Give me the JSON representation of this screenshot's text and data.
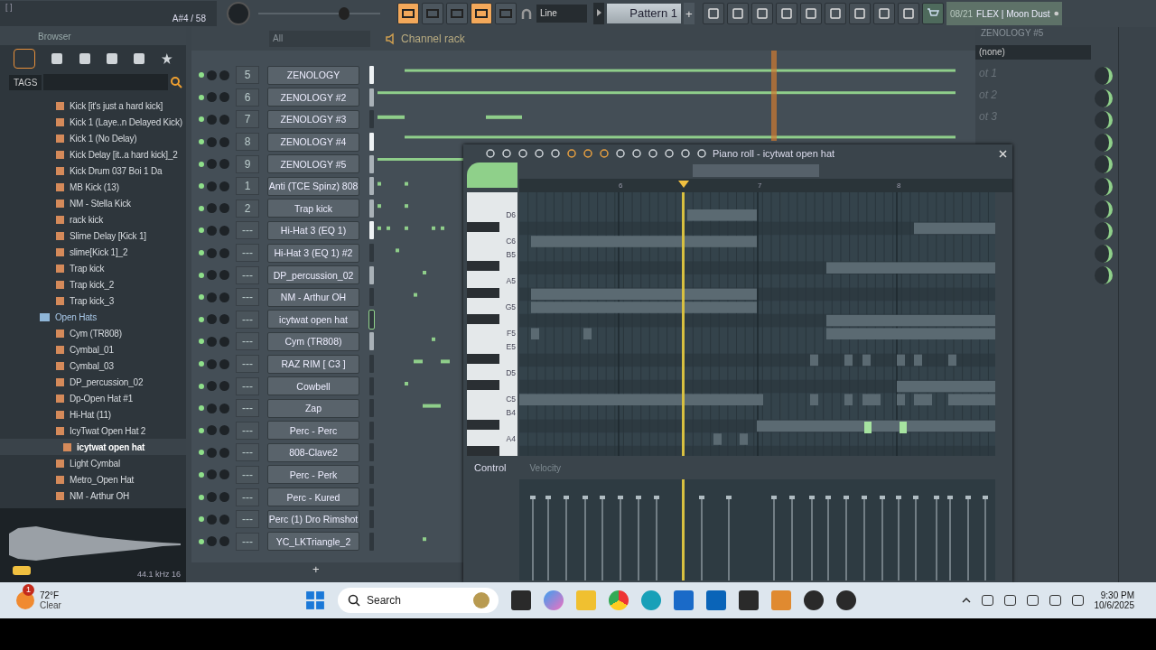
{
  "toolbar": {
    "hint_box": "[ ]",
    "note_readout": "A#4 / 58",
    "master": {
      "level": 0.72
    },
    "buttons": [
      {
        "active": true
      },
      {
        "active": false
      },
      {
        "active": false
      },
      {
        "active": true
      },
      {
        "active": false
      }
    ],
    "snap": "Line",
    "pattern": "Pattern 1",
    "add_pattern": "+",
    "news_count": "08/21",
    "news_title": "FLEX | Moon Dust"
  },
  "browser": {
    "title": "Browser",
    "tags": "TAGS",
    "tree": [
      {
        "kind": "file",
        "label": "Kick [it's just a hard kick]",
        "selected": false
      },
      {
        "kind": "file",
        "label": "Kick 1 (Laye..n Delayed Kick)",
        "selected": false
      },
      {
        "kind": "file",
        "label": "Kick 1 (No Delay)",
        "selected": false
      },
      {
        "kind": "file",
        "label": "Kick Delay [it..a hard kick]_2",
        "selected": false
      },
      {
        "kind": "file",
        "label": "Kick Drum 037 Boi 1 Da",
        "selected": false
      },
      {
        "kind": "file",
        "label": "MB Kick (13)",
        "selected": false
      },
      {
        "kind": "file",
        "label": "NM - Stella Kick",
        "selected": false
      },
      {
        "kind": "file",
        "label": "rack kick",
        "selected": false
      },
      {
        "kind": "file",
        "label": "Slime Delay [Kick 1]",
        "selected": false
      },
      {
        "kind": "file",
        "label": "slime[Kick 1]_2",
        "selected": false
      },
      {
        "kind": "file",
        "label": "Trap kick",
        "selected": false
      },
      {
        "kind": "file",
        "label": "Trap kick_2",
        "selected": false
      },
      {
        "kind": "file",
        "label": "Trap kick_3",
        "selected": false
      },
      {
        "kind": "folder",
        "label": "Open Hats",
        "selected": false,
        "children": [
          {
            "kind": "file",
            "label": "Cym (TR808)",
            "selected": false
          },
          {
            "kind": "file",
            "label": "Cymbal_01",
            "selected": false
          },
          {
            "kind": "file",
            "label": "Cymbal_03",
            "selected": false
          },
          {
            "kind": "file",
            "label": "DP_percussion_02",
            "selected": false
          },
          {
            "kind": "file",
            "label": "Dp-Open Hat #1",
            "selected": false
          },
          {
            "kind": "file",
            "label": "Hi-Hat (11)",
            "selected": false
          },
          {
            "kind": "file",
            "label": "IcyTwat Open Hat 2",
            "selected": false,
            "children": [
              {
                "kind": "file",
                "label": "icytwat open hat",
                "selected": true
              }
            ]
          },
          {
            "kind": "file",
            "label": "Light Cymbal",
            "selected": false
          },
          {
            "kind": "file",
            "label": "Metro_Open Hat",
            "selected": false
          },
          {
            "kind": "file",
            "label": "NM - Arthur OH",
            "selected": false
          }
        ]
      }
    ],
    "sample_info": "44.1 kHz 16"
  },
  "channel_rack": {
    "filter": "All",
    "title": "Channel rack",
    "add": "+",
    "channels": [
      {
        "number": "5",
        "name": "ZENOLOGY",
        "color": "#eef2f4",
        "selected": false
      },
      {
        "number": "6",
        "name": "ZENOLOGY #2",
        "color": "#a9b1b7",
        "selected": false
      },
      {
        "number": "7",
        "name": "ZENOLOGY #3",
        "color": "#2f373d",
        "selected": false
      },
      {
        "number": "8",
        "name": "ZENOLOGY #4",
        "color": "#eef2f4",
        "selected": false
      },
      {
        "number": "9",
        "name": "ZENOLOGY #5",
        "color": "#a9b1b7",
        "selected": false
      },
      {
        "number": "1",
        "name": "Anti (TCE Spinz) 808",
        "color": "#a9b1b7",
        "selected": false
      },
      {
        "number": "2",
        "name": "Trap kick",
        "color": "#a9b1b7",
        "selected": false
      },
      {
        "number": "---",
        "name": "Hi-Hat 3 (EQ 1)",
        "color": "#eef2f4",
        "selected": false
      },
      {
        "number": "---",
        "name": "Hi-Hat 3 (EQ 1) #2",
        "color": "#2f373d",
        "selected": false
      },
      {
        "number": "---",
        "name": "DP_percussion_02",
        "color": "#a9b1b7",
        "selected": false
      },
      {
        "number": "---",
        "name": "NM - Arthur OH",
        "color": "#2f373d",
        "selected": false
      },
      {
        "number": "---",
        "name": "icytwat open hat",
        "color": "#2f373d",
        "selected": true
      },
      {
        "number": "---",
        "name": "Cym (TR808)",
        "color": "#a9b1b7",
        "selected": false
      },
      {
        "number": "---",
        "name": "RAZ RIM [ C3 ]",
        "color": "#2f373d",
        "selected": false
      },
      {
        "number": "---",
        "name": "Cowbell",
        "color": "#2f373d",
        "selected": false
      },
      {
        "number": "---",
        "name": "Zap",
        "color": "#2f373d",
        "selected": false
      },
      {
        "number": "---",
        "name": "Perc - Perc",
        "color": "#2f373d",
        "selected": false
      },
      {
        "number": "---",
        "name": "808-Clave2",
        "color": "#2f373d",
        "selected": false
      },
      {
        "number": "---",
        "name": "Perc - Perk",
        "color": "#2f373d",
        "selected": false
      },
      {
        "number": "---",
        "name": "Perc - Kured",
        "color": "#2f373d",
        "selected": false
      },
      {
        "number": "---",
        "name": "Perc (1) Dro Rimshot",
        "color": "#2f373d",
        "selected": false
      },
      {
        "number": "---",
        "name": "YC_LKTriangle_2",
        "color": "#2f373d",
        "selected": false
      }
    ]
  },
  "piano_roll": {
    "title": "Piano roll - icytwat open hat",
    "ruler": [
      "6",
      "7",
      "8"
    ],
    "keys": [
      "D6",
      "C6",
      "B5",
      "A5",
      "G5",
      "F5",
      "E5",
      "D5",
      "C5",
      "B4",
      "A4"
    ],
    "control": "Control",
    "lane": "Velocity"
  },
  "plugin": {
    "title": "ZENOLOGY #5",
    "preset": "(none)",
    "parts": [
      "ot 1",
      "ot 2",
      "ot 3"
    ]
  },
  "taskbar": {
    "badge": "1",
    "temperature": "72°F",
    "condition": "Clear",
    "search": {
      "placeholder": "Search"
    },
    "time": "9:30 PM",
    "date": "10/6/2025"
  }
}
